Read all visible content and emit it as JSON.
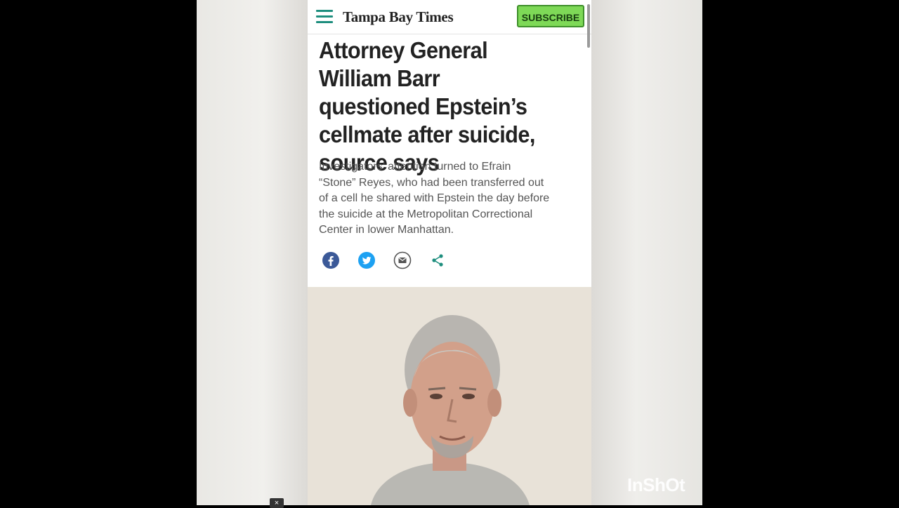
{
  "header": {
    "logo_text": "Tampa Bay Times",
    "subscribe_label": "SUBSCRIBE",
    "menu_icon": "hamburger-menu-icon"
  },
  "article": {
    "headline": "Attorney General William Barr questioned Epstein’s cellmate after suicide, source says",
    "dek": "Investigators’ attention turned to Efrain “Stone” Reyes, who had been transferred out of a cell he shared with Epstein the day before the suicide at the Metropolitan Correctional Center in lower Manhattan."
  },
  "share": {
    "items": [
      {
        "name": "facebook",
        "icon": "facebook-icon",
        "color": "#3b5998"
      },
      {
        "name": "twitter",
        "icon": "twitter-icon",
        "color": "#1da1f2"
      },
      {
        "name": "email",
        "icon": "email-icon",
        "color": "#555555"
      },
      {
        "name": "share",
        "icon": "share-icon",
        "color": "#1e8e7e"
      }
    ]
  },
  "overlay": {
    "watermark": "InShOt",
    "close_label": "×"
  },
  "colors": {
    "accent": "#1e8e7e",
    "subscribe_bg": "#7ed957"
  }
}
